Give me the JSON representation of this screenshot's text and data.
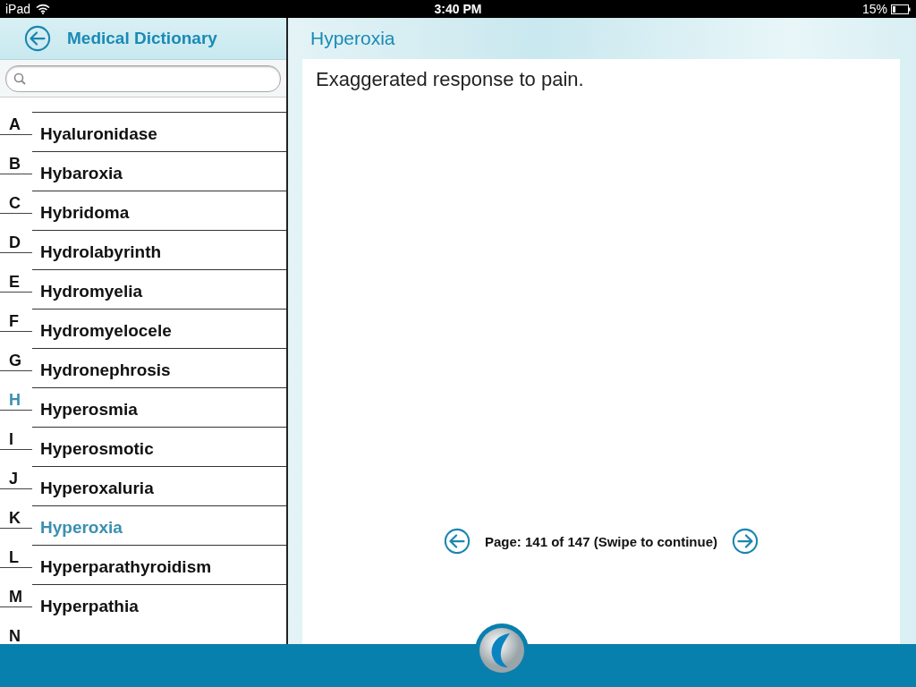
{
  "status_bar": {
    "device": "iPad",
    "time": "3:40 PM",
    "battery": "15%"
  },
  "sidebar": {
    "title": "Medical Dictionary",
    "index": [
      {
        "label": "A",
        "selected": false
      },
      {
        "label": "B",
        "selected": false
      },
      {
        "label": "C",
        "selected": false
      },
      {
        "label": "D",
        "selected": false
      },
      {
        "label": "E",
        "selected": false
      },
      {
        "label": "F",
        "selected": false
      },
      {
        "label": "G",
        "selected": false
      },
      {
        "label": "H",
        "selected": true
      },
      {
        "label": "I",
        "selected": false
      },
      {
        "label": "J",
        "selected": false
      },
      {
        "label": "K",
        "selected": false
      },
      {
        "label": "L",
        "selected": false
      },
      {
        "label": "M",
        "selected": false
      },
      {
        "label": "N",
        "selected": false
      }
    ],
    "items": [
      {
        "label": "Hyaluronidase",
        "selected": false
      },
      {
        "label": "Hybaroxia",
        "selected": false
      },
      {
        "label": "Hybridoma",
        "selected": false
      },
      {
        "label": "Hydrolabyrinth",
        "selected": false
      },
      {
        "label": "Hydromyelia",
        "selected": false
      },
      {
        "label": "Hydromyelocele",
        "selected": false
      },
      {
        "label": "Hydronephrosis",
        "selected": false
      },
      {
        "label": "Hyperosmia",
        "selected": false
      },
      {
        "label": "Hyperosmotic",
        "selected": false
      },
      {
        "label": "Hyperoxaluria",
        "selected": false
      },
      {
        "label": "Hyperoxia",
        "selected": true
      },
      {
        "label": "Hyperparathyroidism",
        "selected": false
      },
      {
        "label": "Hyperpathia",
        "selected": false
      }
    ]
  },
  "detail": {
    "title": "Hyperoxia",
    "definition": "Exaggerated response to pain.",
    "pager": "Page: 141 of 147 (Swipe to continue)"
  }
}
